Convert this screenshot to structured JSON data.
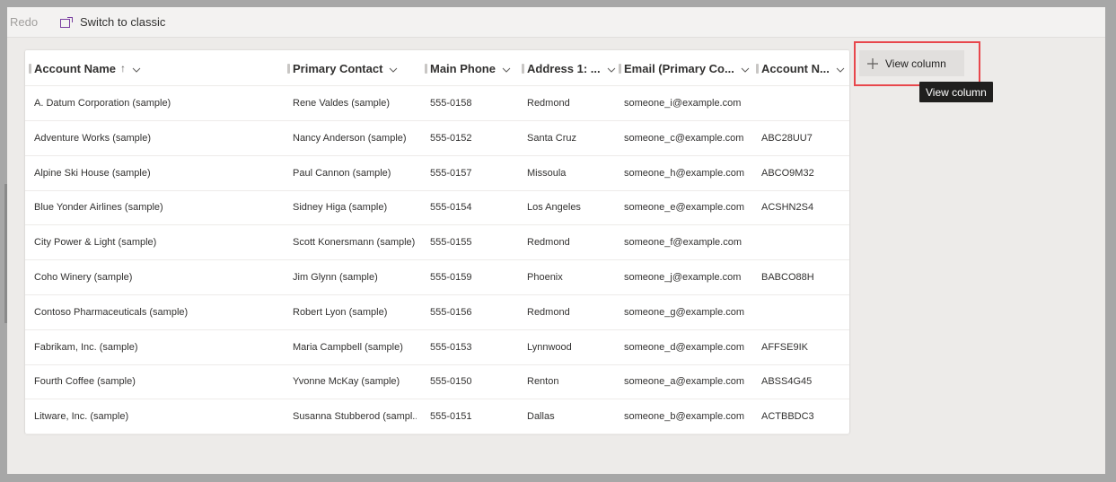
{
  "commandbar": {
    "redo_label": "Redo",
    "switch_label": "Switch to classic"
  },
  "grid": {
    "columns": [
      {
        "label": "Account Name",
        "sort": "↑"
      },
      {
        "label": "Primary Contact",
        "sort": ""
      },
      {
        "label": "Main Phone",
        "sort": ""
      },
      {
        "label": "Address 1: ...",
        "sort": ""
      },
      {
        "label": "Email (Primary Co...",
        "sort": ""
      },
      {
        "label": "Account N...",
        "sort": ""
      }
    ],
    "rows": [
      [
        "A. Datum Corporation (sample)",
        "Rene Valdes (sample)",
        "555-0158",
        "Redmond",
        "someone_i@example.com",
        ""
      ],
      [
        "Adventure Works (sample)",
        "Nancy Anderson (sample)",
        "555-0152",
        "Santa Cruz",
        "someone_c@example.com",
        "ABC28UU7"
      ],
      [
        "Alpine Ski House (sample)",
        "Paul Cannon (sample)",
        "555-0157",
        "Missoula",
        "someone_h@example.com",
        "ABCO9M32"
      ],
      [
        "Blue Yonder Airlines (sample)",
        "Sidney Higa (sample)",
        "555-0154",
        "Los Angeles",
        "someone_e@example.com",
        "ACSHN2S4"
      ],
      [
        "City Power & Light (sample)",
        "Scott Konersmann (sample)",
        "555-0155",
        "Redmond",
        "someone_f@example.com",
        ""
      ],
      [
        "Coho Winery (sample)",
        "Jim Glynn (sample)",
        "555-0159",
        "Phoenix",
        "someone_j@example.com",
        "BABCO88H"
      ],
      [
        "Contoso Pharmaceuticals (sample)",
        "Robert Lyon (sample)",
        "555-0156",
        "Redmond",
        "someone_g@example.com",
        ""
      ],
      [
        "Fabrikam, Inc. (sample)",
        "Maria Campbell (sample)",
        "555-0153",
        "Lynnwood",
        "someone_d@example.com",
        "AFFSE9IK"
      ],
      [
        "Fourth Coffee (sample)",
        "Yvonne McKay (sample)",
        "555-0150",
        "Renton",
        "someone_a@example.com",
        "ABSS4G45"
      ],
      [
        "Litware, Inc. (sample)",
        "Susanna Stubberod (sampl...",
        "555-0151",
        "Dallas",
        "someone_b@example.com",
        "ACTBBDC3"
      ]
    ]
  },
  "view_column": {
    "button_label": "View column",
    "tooltip": "View column",
    "highlight_color": "#e8474c"
  },
  "icons": {
    "switch": "switch-classic-icon",
    "plus": "plus-icon",
    "chevron": "chevron-down-icon"
  }
}
